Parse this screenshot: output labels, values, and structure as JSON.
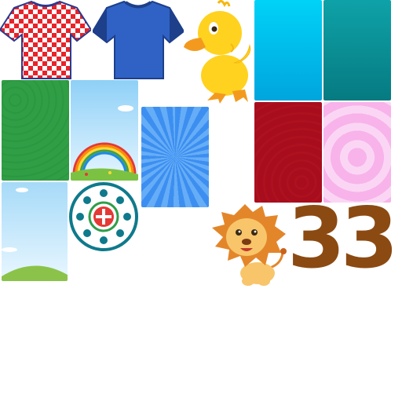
{
  "atlas": {
    "sprites": [
      {
        "name": "checkered-shirt-icon",
        "colors": [
          "#e8232a",
          "#ffffff",
          "#2a3b8f"
        ]
      },
      {
        "name": "blue-shirt-icon",
        "colors": [
          "#2f62c4",
          "#1e3f8a"
        ]
      },
      {
        "name": "duck-icon",
        "colors": [
          "#ffd21f",
          "#f39a1e"
        ]
      },
      {
        "name": "card-cyan",
        "colors": [
          "#00c9f2",
          "#00a8e0"
        ]
      },
      {
        "name": "card-teal",
        "colors": [
          "#0b9aa0",
          "#087c83"
        ]
      },
      {
        "name": "card-green",
        "colors": [
          "#2f9e45",
          "#23863a"
        ]
      },
      {
        "name": "card-rainbow-sky",
        "colors": [
          "#b9e3fb",
          "#ffffff"
        ]
      },
      {
        "name": "card-blue-sunburst",
        "colors": [
          "#3c8ff0",
          "#62a9f6"
        ]
      },
      {
        "name": "card-red",
        "colors": [
          "#a80d1e",
          "#c0172a"
        ]
      },
      {
        "name": "card-pink-rings",
        "colors": [
          "#f6a9e6",
          "#fbd2f3"
        ]
      },
      {
        "name": "card-sky-hill",
        "colors": [
          "#bfe5fb",
          "#8bc34a"
        ]
      },
      {
        "name": "mandala-medallion-icon",
        "colors": [
          "#0e7a8c",
          "#e53935"
        ]
      },
      {
        "name": "lion-icon",
        "colors": [
          "#e3862a",
          "#f8c56b"
        ]
      }
    ],
    "number_text": "33",
    "number_color": "#8b4a12"
  }
}
